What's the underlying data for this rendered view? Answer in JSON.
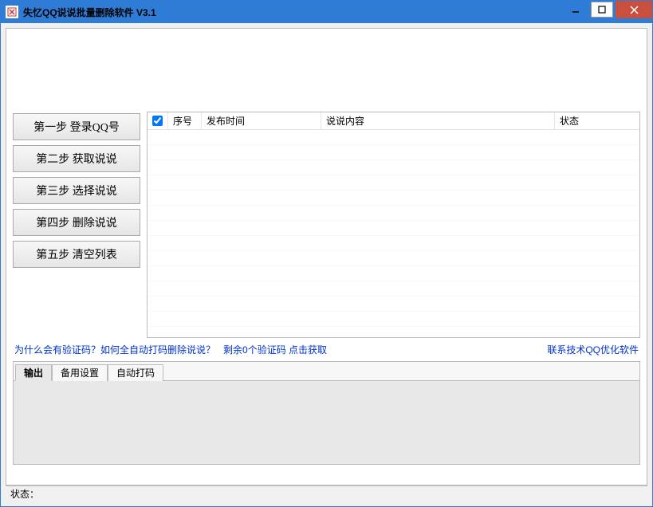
{
  "window": {
    "title": "失忆QQ说说批量删除软件 V3.1"
  },
  "steps": [
    "第一步  登录QQ号",
    "第二步  获取说说",
    "第三步  选择说说",
    "第四步  删除说说",
    "第五步  清空列表"
  ],
  "table": {
    "columns": {
      "seq": "序号",
      "time": "发布时间",
      "content": "说说内容",
      "status": "状态"
    },
    "select_all_checked": true,
    "rows": []
  },
  "links": {
    "why_captcha": "为什么会有验证码？",
    "auto_captcha": "如何全自动打码删除说说？",
    "remaining": "剩余0个验证码 点击获取",
    "contact": "联系技术QQ优化软件"
  },
  "tabs": {
    "items": [
      "输出",
      "备用设置",
      "自动打码"
    ],
    "active_index": 0
  },
  "statusbar": {
    "label": "状态："
  }
}
